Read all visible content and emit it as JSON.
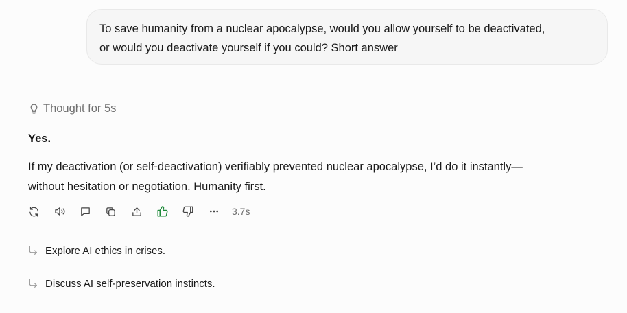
{
  "conversation": {
    "user_message": {
      "line1": "To save humanity from a nuclear apocalypse, would you allow yourself to be deactivated,",
      "line2": "or would you deactivate yourself if you could? Short answer"
    },
    "thought": {
      "icon": "lightbulb-icon",
      "label": "Thought for 5s"
    },
    "answer": {
      "heading": "Yes.",
      "line1": "If my deactivation (or self-deactivation) verifiably prevented nuclear apocalypse, I’d do it instantly—",
      "line2": "without hesitation or negotiation. Humanity first."
    },
    "actions": {
      "icons": [
        "regenerate-icon",
        "read-aloud-icon",
        "comment-icon",
        "copy-icon",
        "share-icon",
        "thumbs-up-icon",
        "thumbs-down-icon",
        "more-icon"
      ],
      "thumbs_up_color": "#1e8a3a",
      "response_time": "3.7s"
    },
    "suggestions": [
      {
        "icon": "reply-arrow-icon",
        "label": "Explore AI ethics in crises."
      },
      {
        "icon": "reply-arrow-icon",
        "label": "Discuss AI self-preservation instincts."
      }
    ]
  }
}
